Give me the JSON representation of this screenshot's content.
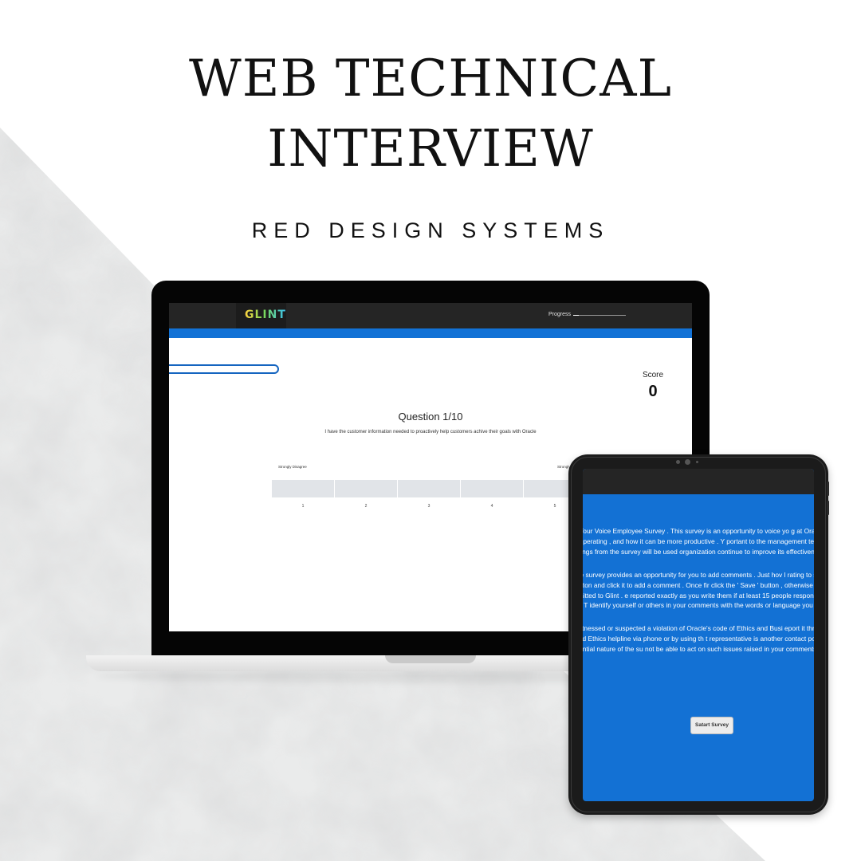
{
  "poster": {
    "title_line1": "WEB TECHNICAL",
    "title_line2": "INTERVIEW",
    "subtitle": "RED DESIGN SYSTEMS"
  },
  "laptop_app": {
    "logo": "GLINT",
    "progress_label": "Progress",
    "progress_fraction": 0.1,
    "score_label": "Score",
    "score_value": "0",
    "question_title": "Question 1/10",
    "question_text": "I have the customer information needed to proactively help customers achive their goals with Oracle",
    "scale_min_label": "Strongly Disagree",
    "scale_max_label": "Strongly",
    "rating_options": [
      "1",
      "2",
      "3",
      "4",
      "5"
    ]
  },
  "tablet_app": {
    "paragraphs": [
      "ome to the Your Voice Employee Survey . This survey is an opportunity to voice yo g at Oracle, how the business is operating , and how it can be more productive . Y portant to the management team , and key findings from the survey will be used organization continue to improve its effectiveness.",
      "y item in the survey provides an opportunity for you to add comments . Just hov l rating to show the ' + Comment ' button and click it to add a comment . Once fir click the ' Save ' button , otherwise your response will not be submitted to Glint . e reported exactly as you write them if at least 15 people respond to a question . T identify yourself or others in your comments with the words or language you",
      "If you have witnessed or suspected a violation of Oracle's code of Ethics and Busi eport it through Oracle's Compliance and Ethics helpline via phone or by using th t representative is another contact point . Due to the confidential nature of the su not be able to act on such issues raised in your comments here ."
    ],
    "start_button": "Satart Survey"
  },
  "colors": {
    "brand_blue": "#1272d6",
    "header_dark": "#252525",
    "device_black": "#050505"
  }
}
